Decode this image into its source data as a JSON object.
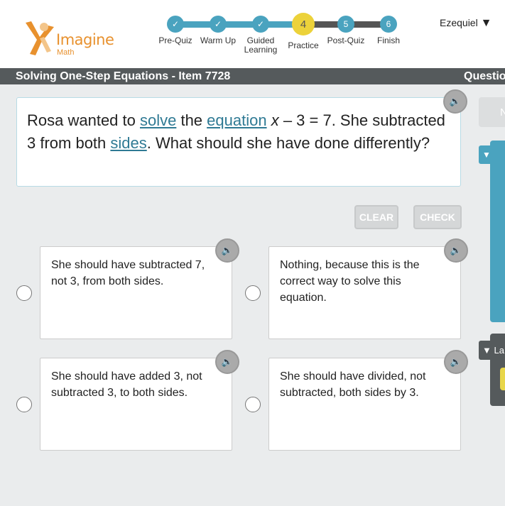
{
  "logo": {
    "name": "Imagine",
    "sub": "Math"
  },
  "progress": {
    "steps": [
      {
        "label": "Pre-Quiz",
        "state": "done",
        "num": ""
      },
      {
        "label": "Warm Up",
        "state": "done",
        "num": ""
      },
      {
        "label": "Guided Learning",
        "state": "done",
        "num": ""
      },
      {
        "label": "Practice",
        "state": "current",
        "num": "4"
      },
      {
        "label": "Post-Quiz",
        "state": "todo",
        "num": "5"
      },
      {
        "label": "Finish",
        "state": "todo",
        "num": "6"
      }
    ]
  },
  "user": {
    "name": "Ezequiel"
  },
  "titlebar": {
    "title": "Solving One-Step Equations - Item 7728",
    "right": "Questio"
  },
  "question": {
    "p1": "Rosa wanted to ",
    "l1": "solve",
    "p2": " the ",
    "l2": "equation",
    "p3": " ",
    "math": "x",
    "p4": " – 3 = 7. She subtracted 3 from both ",
    "l3": "sides",
    "p5": ". What should she have done differently?"
  },
  "buttons": {
    "clear": "CLEAR",
    "check": "CHECK"
  },
  "choices": [
    "She should have subtracted 7, not 3, from both sides.",
    "Nothing, because this is the correct way to solve this equation.",
    "She should have added 3, not subtracted 3, to both sides.",
    "She should have divided, not subtracted, both sides by 3."
  ],
  "side": {
    "top_button": "N",
    "panel2_label": "La"
  },
  "colors": {
    "teal": "#4aa3bf",
    "current": "#ecd23a",
    "orange": "#e8912e"
  }
}
